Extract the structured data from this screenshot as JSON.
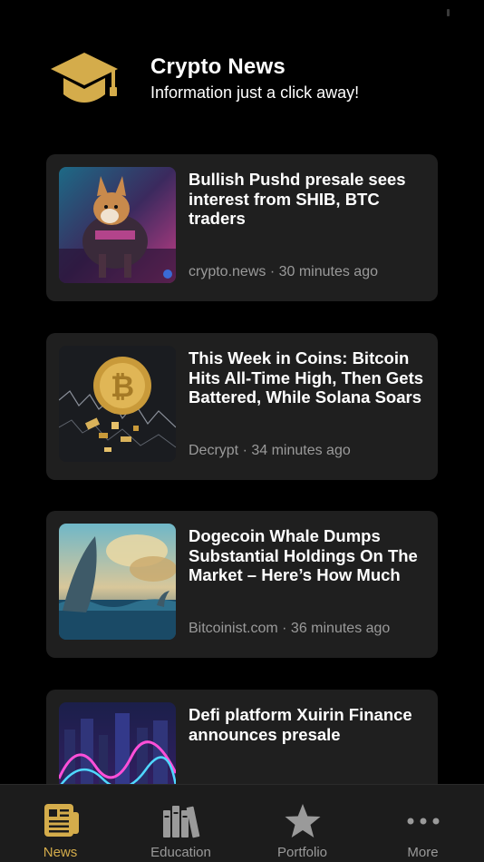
{
  "header": {
    "title": "Crypto News",
    "subtitle": "Information just a click away!",
    "logo_icon": "graduation-cap-icon",
    "accent_color": "#d4ac4b"
  },
  "news": {
    "items": [
      {
        "title": "Bullish Pushd presale sees interest from SHIB, BTC traders",
        "source": "crypto.news",
        "time": "30 minutes ago"
      },
      {
        "title": "This Week in Coins: Bitcoin Hits All-Time High, Then Gets Battered, While Solana Soars",
        "source": "Decrypt",
        "time": "34 minutes ago"
      },
      {
        "title": "Dogecoin Whale Dumps Substantial Holdings On The Market – Here’s How Much",
        "source": "Bitcoinist.com",
        "time": "36 minutes ago"
      },
      {
        "title": "Defi platform Xuirin Finance announces presale",
        "source": "",
        "time": ""
      }
    ]
  },
  "tabbar": {
    "tabs": [
      {
        "label": "News",
        "icon": "newspaper-icon",
        "active": true
      },
      {
        "label": "Education",
        "icon": "books-icon",
        "active": false
      },
      {
        "label": "Portfolio",
        "icon": "star-icon",
        "active": false
      },
      {
        "label": "More",
        "icon": "ellipsis-icon",
        "active": false
      }
    ]
  }
}
